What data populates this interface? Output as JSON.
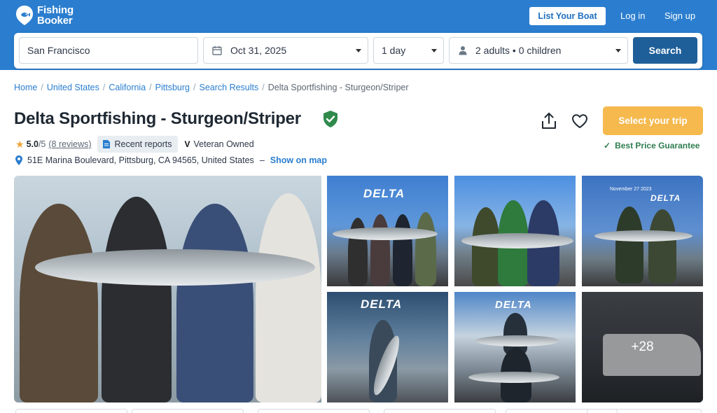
{
  "header": {
    "logo_line1": "Fishing",
    "logo_line2": "Booker",
    "list_boat": "List Your Boat",
    "login": "Log in",
    "signup": "Sign up",
    "brand_color": "#2b7ecf"
  },
  "search": {
    "location": "San Francisco",
    "date": "Oct 31, 2025",
    "duration": "1 day",
    "guests": "2 adults • 0 children",
    "button": "Search"
  },
  "breadcrumb": {
    "items": [
      "Home",
      "United States",
      "California",
      "Pittsburg",
      "Search Results"
    ],
    "current": "Delta Sportfishing - Sturgeon/Striper"
  },
  "listing": {
    "title": "Delta Sportfishing - Sturgeon/Striper",
    "rating": "5.0",
    "rating_of": "/5",
    "reviews": "(8 reviews)",
    "recent_reports": "Recent reports",
    "veteran_owned": "Veteran Owned",
    "address": "51E Marina Boulevard, Pittsburg, CA 94565, United States",
    "dash": "–",
    "show_on_map": "Show on map"
  },
  "actions": {
    "select_trip": "Select your trip",
    "best_price": "Best Price Guarantee",
    "accent_color": "#f5b94d"
  },
  "gallery": {
    "more_count": "+28",
    "p3_date": "November 27 2023"
  }
}
